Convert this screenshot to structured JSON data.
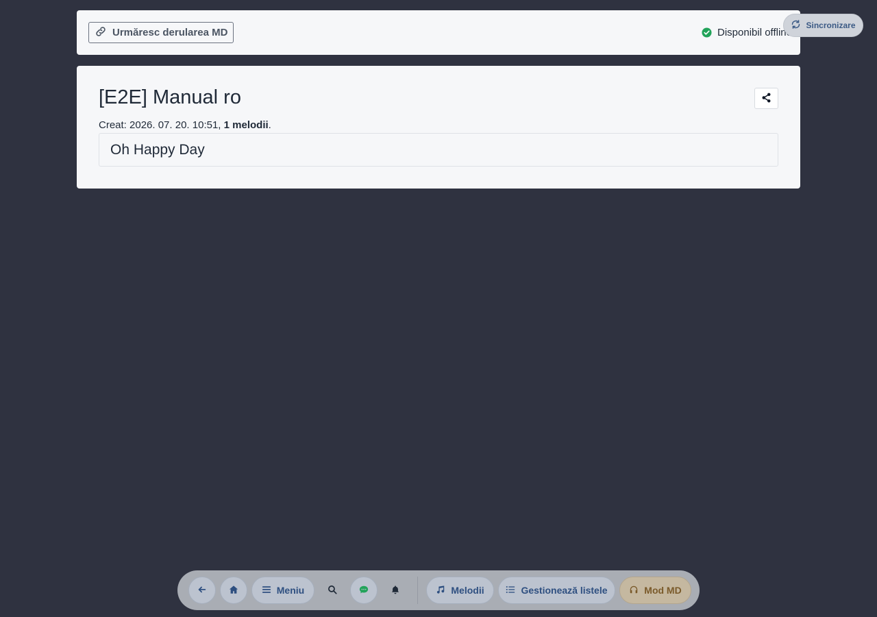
{
  "topbar": {
    "follow_label": "Urmăresc derularea MD",
    "offline_label": "Disponibil offline",
    "sync_label": "Sincronizare"
  },
  "list": {
    "title": "[E2E] Manual ro",
    "created_prefix": "Creat: 2026. 07. 20. 10:51, ",
    "song_count": "1 melodii",
    "created_suffix": ".",
    "songs": [
      "Oh Happy Day"
    ]
  },
  "dock": {
    "menu_label": "Meniu",
    "songs_label": "Melodii",
    "manage_label": "Gestionează listele",
    "md_label": "Mod MD"
  },
  "colors": {
    "background": "#2f3240",
    "panel": "#f6f7f9",
    "accent": "#2e4f80",
    "success": "#22a35a",
    "md_accent": "#7a5a2a"
  },
  "icons": {
    "follow": "link-icon",
    "offline": "check-circle-icon",
    "sync": "sync-icon",
    "share": "share-icon",
    "back": "arrow-left-icon",
    "home": "home-icon",
    "menu": "hamburger-icon",
    "search": "search-icon",
    "chat": "chat-icon",
    "notifications": "bell-icon",
    "songs": "music-note-icon",
    "manage": "list-icon",
    "md": "headphones-icon"
  }
}
